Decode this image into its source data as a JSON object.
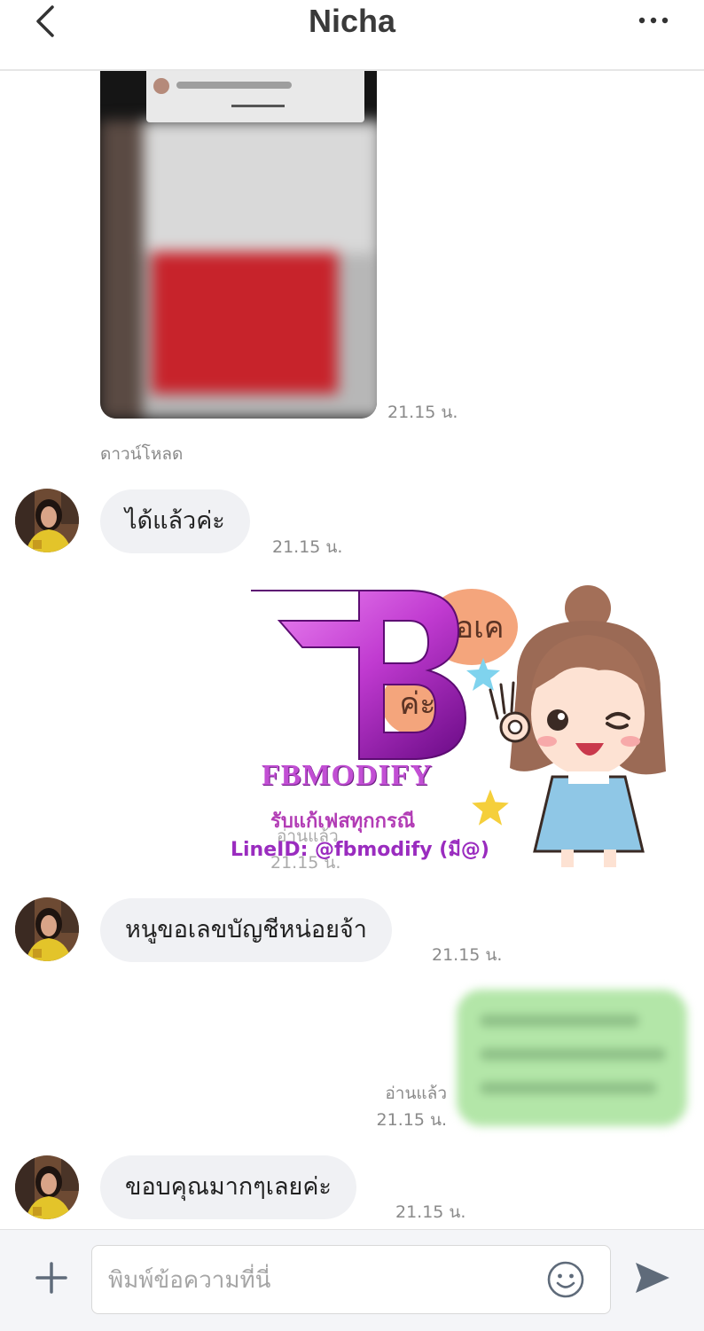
{
  "header": {
    "title": "Nicha"
  },
  "chat": {
    "image_message": {
      "time": "21.15 น.",
      "download_label": "ดาวน์โหลด"
    },
    "messages": [
      {
        "text": "ได้แล้วค่ะ",
        "time": "21.15 น."
      },
      {
        "text": "หนูขอเลขบัญชีหน่อยจ้า",
        "time": "21.15 น."
      },
      {
        "text": "ขอบคุณมากๆเลยค่ะ",
        "time": "21.15 น."
      }
    ],
    "sticker": {
      "word_top": "โอเค",
      "word_bottom": "ค่ะ",
      "read_status": "อ่านแล้ว",
      "time": "21.15 น."
    },
    "outgoing": {
      "read_status": "อ่านแล้ว",
      "time": "21.15 น."
    }
  },
  "watermark": {
    "brand": "FBMODIFY",
    "line1": "รับแก้เฟสทุกกรณี",
    "line2": "LineID: @fbmodify (มี@)"
  },
  "input_bar": {
    "placeholder": "พิมพ์ข้อความที่นี่"
  },
  "colors": {
    "outgoing_bubble": "#b3e6a8",
    "incoming_bubble": "#f0f1f4",
    "watermark_purple": "#b23cb5"
  },
  "icons": {
    "back": "chevron-left-icon",
    "more": "more-horizontal-icon",
    "add": "plus-icon",
    "emoji": "smiley-icon",
    "send": "send-icon"
  }
}
